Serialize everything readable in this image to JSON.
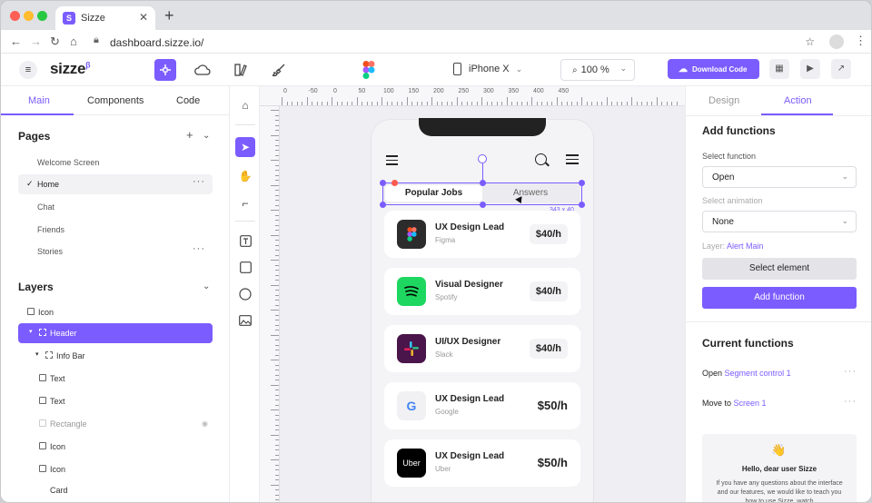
{
  "browser": {
    "tab_title": "Sizze",
    "favicon_letter": "S",
    "url": "dashboard.sizze.io/"
  },
  "toolbar": {
    "logo": "sizze",
    "logo_sup": "β",
    "device": "iPhone X",
    "zoom": "100 %",
    "download_label": "Download Code"
  },
  "left_panel": {
    "tabs": [
      {
        "label": "Main",
        "active": true
      },
      {
        "label": "Components",
        "active": false
      },
      {
        "label": "Code",
        "active": false
      }
    ],
    "pages_title": "Pages",
    "pages": [
      {
        "label": "Welcome Screen"
      },
      {
        "label": "Home",
        "selected": true
      },
      {
        "label": "Chat"
      },
      {
        "label": "Friends"
      },
      {
        "label": "Stories"
      }
    ],
    "layers_title": "Layers",
    "layers": [
      {
        "label": "Icon",
        "icon": "image-icon"
      },
      {
        "label": "Header",
        "icon": "frame-icon",
        "selected": true
      },
      {
        "label": "Info Bar",
        "icon": "frame-icon"
      },
      {
        "label": "Text",
        "icon": "text-icon"
      },
      {
        "label": "Text",
        "icon": "text-icon"
      },
      {
        "label": "Rectangle",
        "icon": "rectangle-icon",
        "hidden": true
      },
      {
        "label": "Icon",
        "icon": "image-icon"
      },
      {
        "label": "Icon",
        "icon": "image-icon"
      },
      {
        "label": "Card",
        "icon": "none"
      }
    ]
  },
  "rulers": {
    "top_labels": [
      "0",
      "-50",
      "0",
      "50",
      "100",
      "150",
      "200",
      "250",
      "300",
      "350",
      "400",
      "450"
    ]
  },
  "canvas": {
    "segment": {
      "active": "Popular Jobs",
      "inactive": "Answers"
    },
    "selection_size": "343 x 40",
    "jobs": [
      {
        "title": "UX Design Lead",
        "company": "Figma",
        "rate": "$40/h",
        "style": "pill",
        "icon_bg": "#2c2c2c",
        "icon_text": "",
        "icon_name": "figma-icon"
      },
      {
        "title": "Visual Designer",
        "company": "Spotify",
        "rate": "$40/h",
        "style": "pill",
        "icon_bg": "#1ed760",
        "icon_text": "",
        "icon_name": "spotify-icon"
      },
      {
        "title": "UI/UX Designer",
        "company": "Slack",
        "rate": "$40/h",
        "style": "pill",
        "icon_bg": "#4a154b",
        "icon_text": "",
        "icon_name": "slack-icon"
      },
      {
        "title": "UX Design Lead",
        "company": "Google",
        "rate": "$50/h",
        "style": "big",
        "icon_bg": "#f1f1f3",
        "icon_text": "G",
        "icon_name": "google-icon"
      },
      {
        "title": "UX Design Lead",
        "company": "Uber",
        "rate": "$50/h",
        "style": "big",
        "icon_bg": "#000000",
        "icon_text": "Uber",
        "icon_name": "uber-icon"
      }
    ]
  },
  "right_panel": {
    "tabs": [
      {
        "label": "Design",
        "active": false
      },
      {
        "label": "Action",
        "active": true
      }
    ],
    "add_functions_title": "Add functions",
    "select_function_label": "Select function",
    "select_function_value": "Open",
    "select_animation_label": "Select animation",
    "select_animation_value": "None",
    "layer_label": "Layer:",
    "layer_value": "Alert Main",
    "select_element_label": "Select element",
    "add_function_label": "Add function",
    "current_functions_title": "Current functions",
    "current_functions": [
      {
        "action": "Open",
        "target": "Segment control 1"
      },
      {
        "action": "Move to",
        "target": "Screen 1"
      }
    ],
    "help_emoji": "👋",
    "help_title": "Hello, dear user Sizze",
    "help_body": "If you have any questions about the interface and our features, we would like to teach you how to use Sizze, watch"
  },
  "colors": {
    "accent": "#7b5cff"
  }
}
